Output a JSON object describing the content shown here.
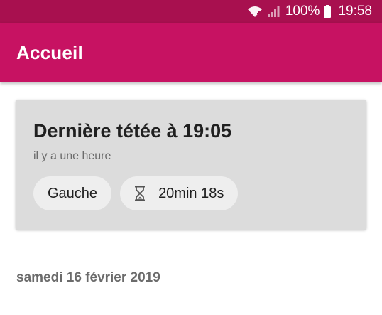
{
  "status_bar": {
    "battery_percent": "100%",
    "time": "19:58",
    "background": "#a8104f"
  },
  "app_bar": {
    "title": "Accueil",
    "background": "#c71262"
  },
  "last_feeding": {
    "headline": "Dernière tétée à 19:05",
    "relative_time": "il y a une heure",
    "side": "Gauche",
    "duration": "20min 18s",
    "duration_icon": "hourglass-icon"
  },
  "history": {
    "date_header": "samedi 16 février 2019"
  }
}
